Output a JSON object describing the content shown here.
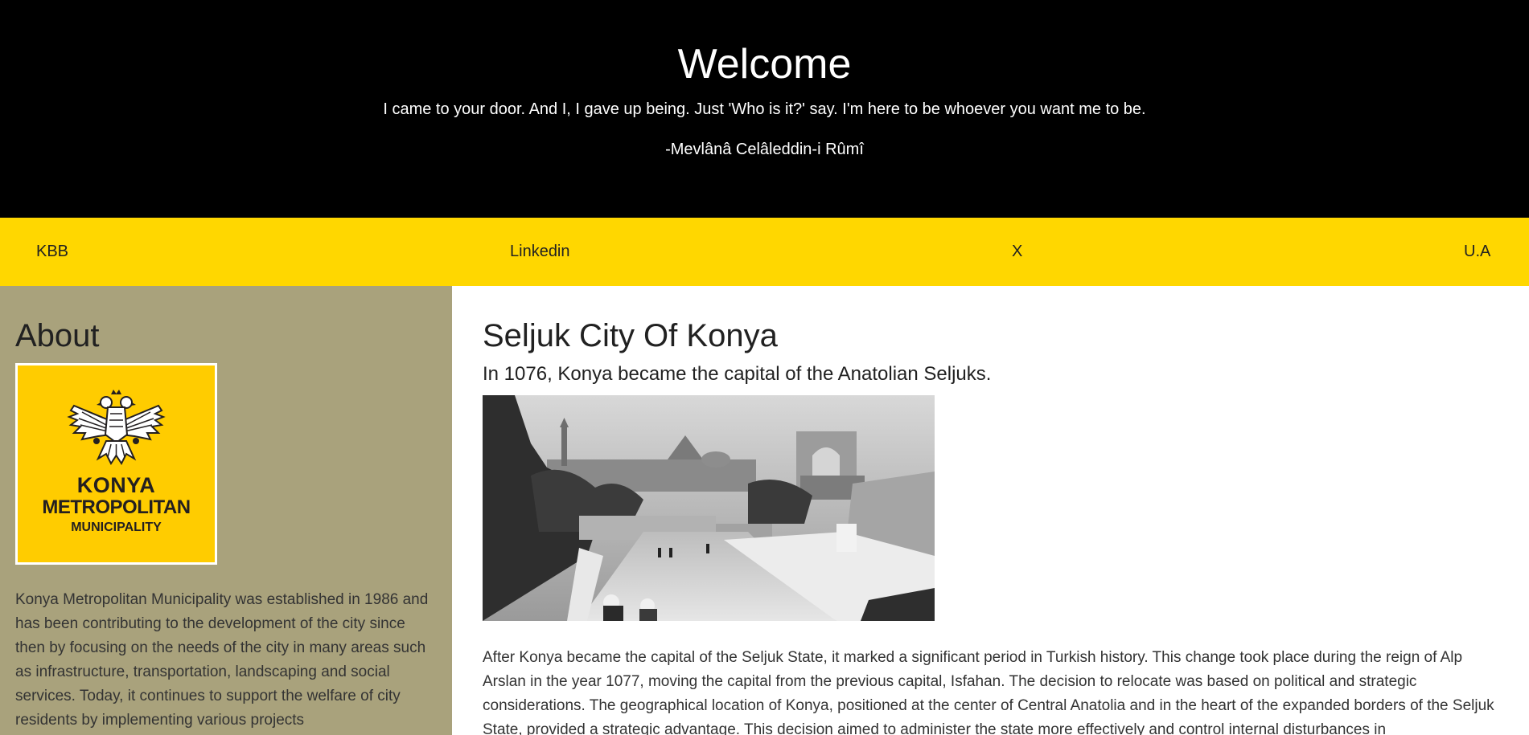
{
  "header": {
    "title": "Welcome",
    "quote": "I came to your door. And I, I gave up being. Just 'Who is it?' say. I'm here to be whoever you want me to be.",
    "author": "-Mevlânâ Celâleddin-i Rûmî"
  },
  "nav": {
    "items": [
      {
        "label": "KBB"
      },
      {
        "label": "Linkedin"
      },
      {
        "label": "X"
      },
      {
        "label": "U.A"
      }
    ]
  },
  "sidebar": {
    "title": "About",
    "logo": {
      "line1": "KONYA",
      "line2": "METROPOLITAN",
      "line3": "MUNICIPALITY",
      "icon": "double-headed-eagle-icon"
    },
    "text": "Konya Metropolitan Municipality was established in 1986 and has been contributing to the development of the city since then by focusing on the needs of the city in many areas such as infrastructure, transportation, landscaping and social services. Today, it continues to support the welfare of city residents by implementing various projects"
  },
  "main": {
    "title": "Seljuk City Of Konya",
    "subtitle": "In 1076, Konya became the capital of the Anatolian Seljuks.",
    "paragraph": "After Konya became the capital of the Seljuk State, it marked a significant period in Turkish history. This change took place during the reign of Alp Arslan in the year 1077, moving the capital from the previous capital, Isfahan. The decision to relocate was based on political and strategic considerations. The geographical location of Konya, positioned at the center of Central Anatolia and in the heart of the expanded borders of the Seljuk State, provided a strategic advantage. This decision aimed to administer the state more effectively and control internal disturbances in"
  },
  "colors": {
    "header_bg": "#000000",
    "nav_bg": "#ffd700",
    "sidebar_bg": "#a9a27c",
    "logo_bg": "#ffcc00"
  }
}
